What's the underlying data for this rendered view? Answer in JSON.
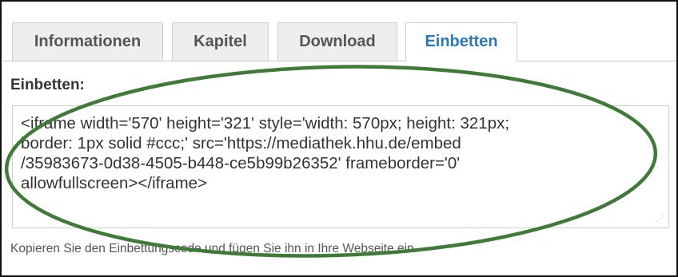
{
  "tabs": [
    {
      "label": "Informationen",
      "active": false
    },
    {
      "label": "Kapitel",
      "active": false
    },
    {
      "label": "Download",
      "active": false
    },
    {
      "label": "Einbetten",
      "active": true
    }
  ],
  "embed": {
    "section_label": "Einbetten:",
    "code_lines": [
      "<iframe width='570' height='321' style='width: 570px; height: 321px;",
      "border: 1px solid #ccc;' src='https://mediathek.hhu.de/embed",
      "/35983673-0d38-4505-b448-ce5b99b26352' frameborder='0'",
      "allowfullscreen></iframe>"
    ],
    "hint": "Kopieren Sie den Einbettungscode und fügen Sie ihn in Ihre Webseite ein."
  },
  "colors": {
    "active_tab_text": "#2a78b8",
    "annotation_ellipse": "#3f7a38"
  }
}
